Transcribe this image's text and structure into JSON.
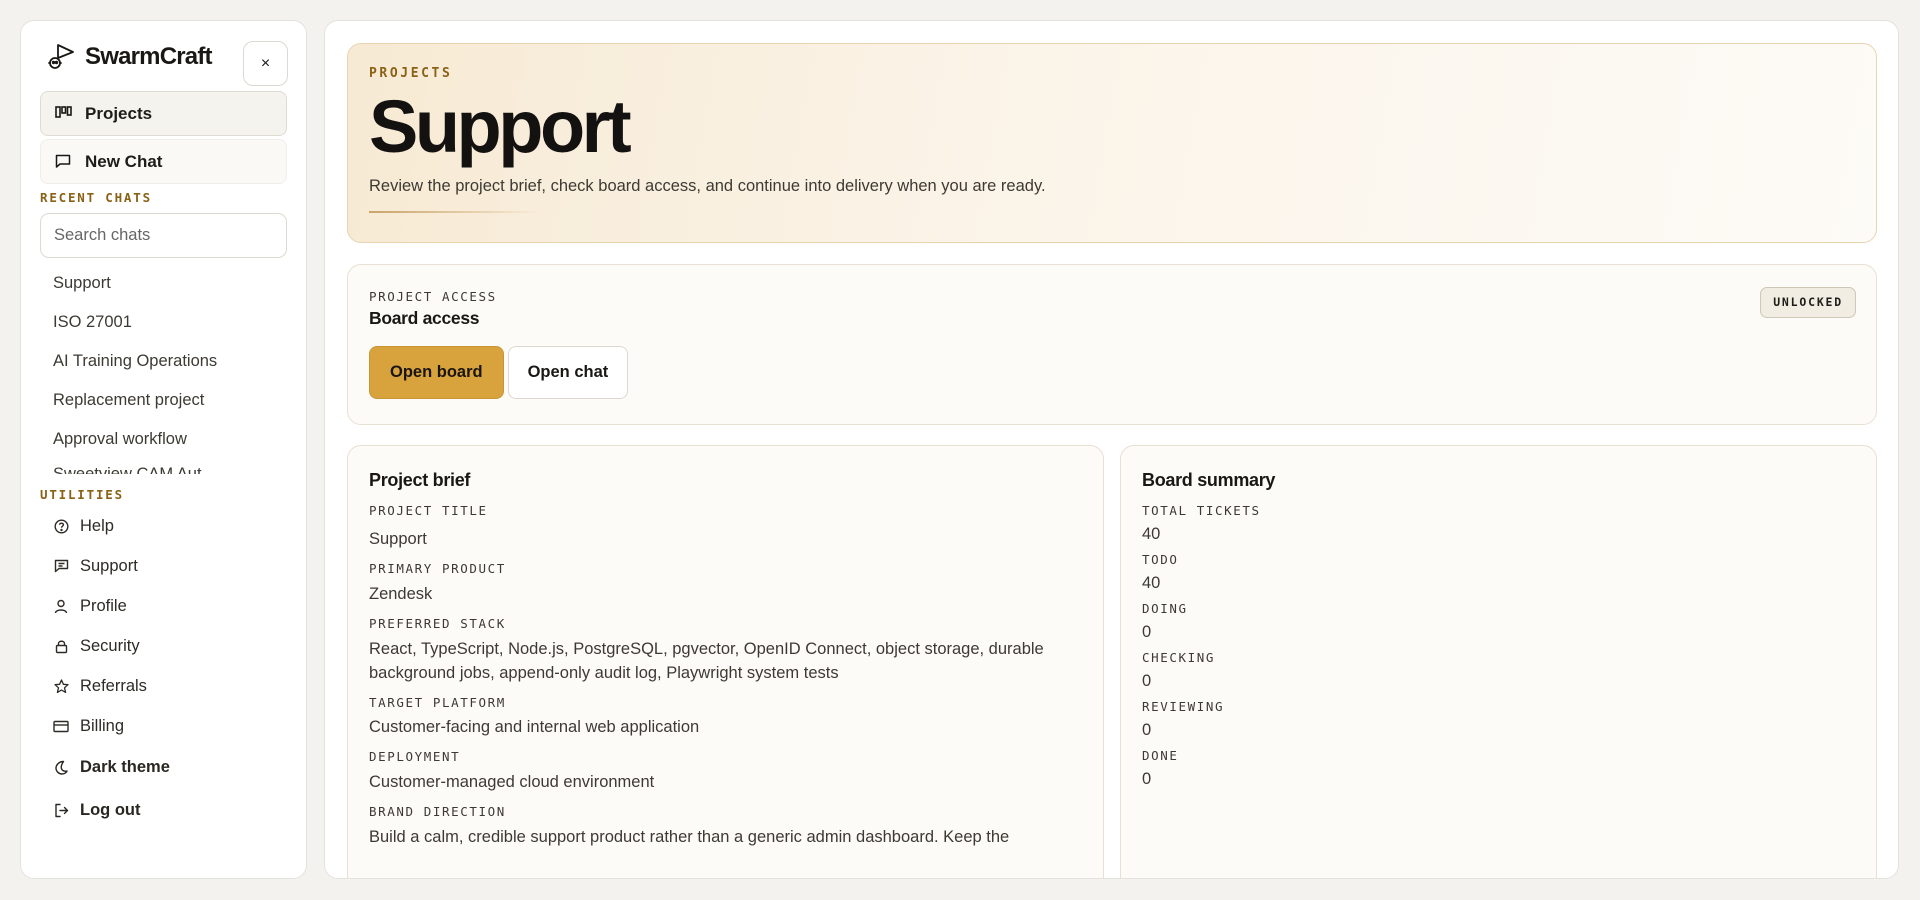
{
  "app": {
    "name": "SwarmCraft"
  },
  "sidebar": {
    "close_label": "×",
    "nav": [
      {
        "label": "Projects",
        "icon": "kanban-icon"
      },
      {
        "label": "New Chat",
        "icon": "chat-icon"
      }
    ],
    "recent_chats_label": "RECENT CHATS",
    "search_placeholder": "Search chats",
    "chats": [
      "Support",
      "ISO 27001",
      "AI Training Operations",
      "Replacement project",
      "Approval workflow",
      "Sweetview CAM Aut..."
    ],
    "utilities_label": "UTILITIES",
    "utilities": [
      {
        "label": "Help",
        "icon": "help-icon"
      },
      {
        "label": "Support",
        "icon": "support-icon"
      },
      {
        "label": "Profile",
        "icon": "profile-icon"
      },
      {
        "label": "Security",
        "icon": "lock-icon"
      },
      {
        "label": "Referrals",
        "icon": "star-icon"
      },
      {
        "label": "Billing",
        "icon": "card-icon"
      }
    ],
    "dark_theme_label": "Dark theme",
    "logout_label": "Log out"
  },
  "hero": {
    "eyebrow": "PROJECTS",
    "title": "Support",
    "description": "Review the project brief, check board access, and continue into delivery when you are ready."
  },
  "access": {
    "eyebrow": "PROJECT ACCESS",
    "title": "Board access",
    "badge": "UNLOCKED",
    "open_board": "Open board",
    "open_chat": "Open chat"
  },
  "brief": {
    "title": "Project brief",
    "fields": [
      {
        "label": "PROJECT TITLE",
        "value": "Support"
      },
      {
        "label": "PRIMARY PRODUCT",
        "value": "Zendesk"
      },
      {
        "label": "PREFERRED STACK",
        "value": "React, TypeScript, Node.js, PostgreSQL, pgvector, OpenID Connect, object storage, durable background jobs, append-only audit log, Playwright system tests"
      },
      {
        "label": "TARGET PLATFORM",
        "value": "Customer-facing and internal web application"
      },
      {
        "label": "DEPLOYMENT",
        "value": "Customer-managed cloud environment"
      },
      {
        "label": "BRAND DIRECTION",
        "value": "Build a calm, credible support product rather than a generic admin dashboard. Keep the"
      }
    ]
  },
  "summary": {
    "title": "Board summary",
    "stats": [
      {
        "label": "TOTAL TICKETS",
        "value": "40"
      },
      {
        "label": "TODO",
        "value": "40"
      },
      {
        "label": "DOING",
        "value": "0"
      },
      {
        "label": "CHECKING",
        "value": "0"
      },
      {
        "label": "REVIEWING",
        "value": "0"
      },
      {
        "label": "DONE",
        "value": "0"
      }
    ]
  },
  "colors": {
    "accent": "#d8a23d",
    "eyebrow": "#8a6115"
  }
}
